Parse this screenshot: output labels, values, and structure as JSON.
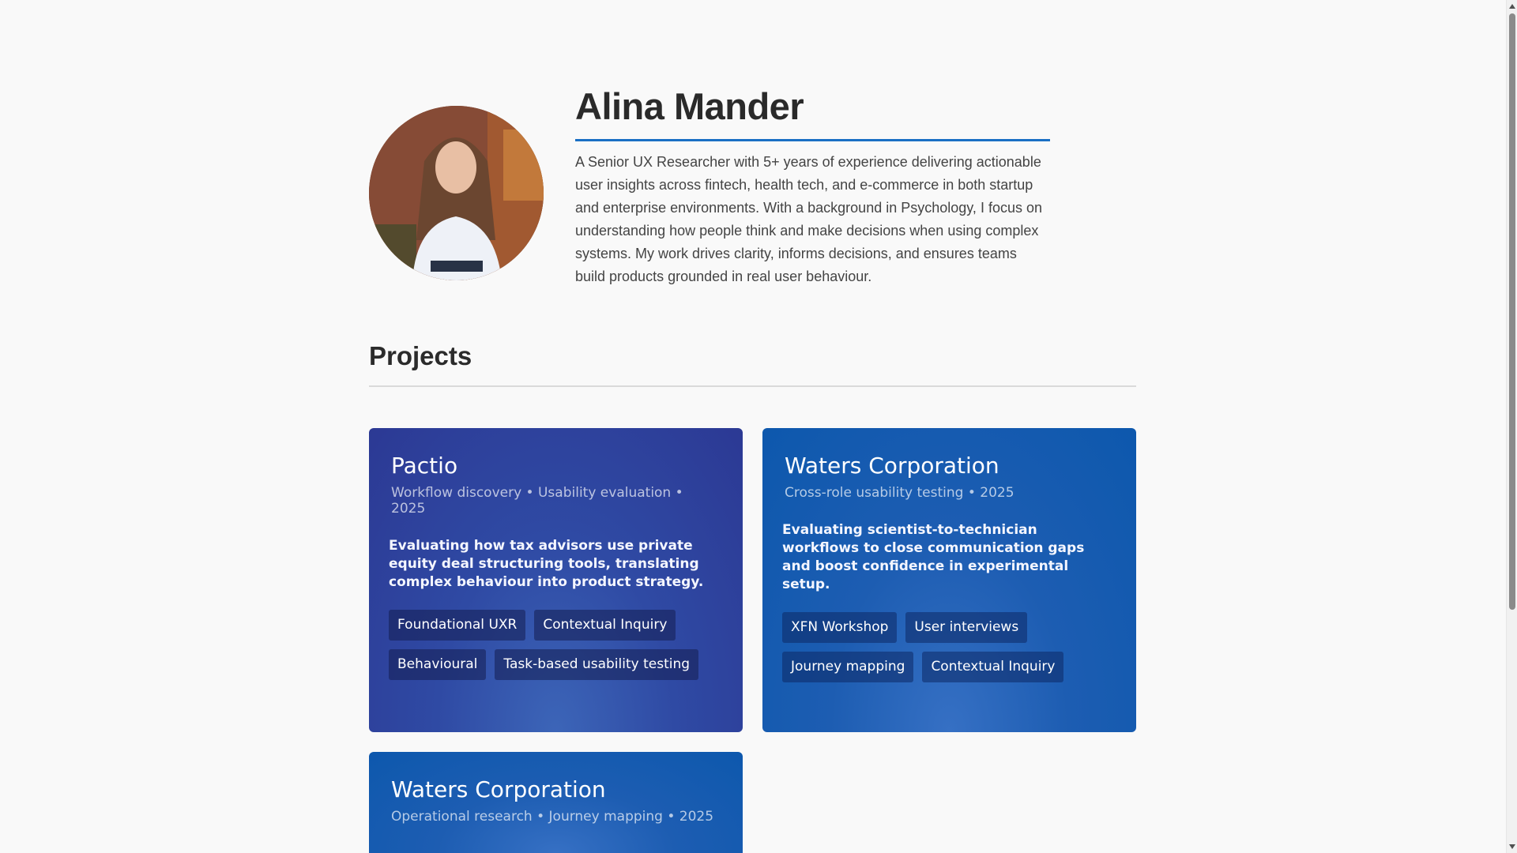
{
  "profile": {
    "name": "Alina Mander",
    "bio": "A Senior UX Researcher with 5+ years of experience delivering actionable user insights across fintech, health tech, and e-commerce in both startup and enterprise environments. With a background in Psychology, I focus on understanding how people think and make decisions when using complex systems. My work drives clarity, informs decisions, and ensures teams build products grounded in real user behaviour."
  },
  "projects": {
    "title": "Projects",
    "cards": [
      {
        "title": "Pactio",
        "meta": "Workflow discovery • Usability evaluation • 2025",
        "description": "Evaluating how tax advisors use private equity deal structuring tools, translating complex behaviour into product strategy.",
        "tags": [
          "Foundational UXR",
          "Contextual Inquiry",
          "Behavioural",
          "Task-based usability testing"
        ],
        "theme": "#2c3994"
      },
      {
        "title": "Waters Corporation",
        "meta": "Cross-role usability testing • 2025",
        "description": "Evaluating scientist-to-technician workflows to close communication gaps and boost confidence in experimental setup.",
        "tags": [
          "XFN Workshop",
          "User interviews",
          "Journey mapping",
          "Contextual Inquiry"
        ],
        "theme": "#0d58ad"
      },
      {
        "title": "Waters Corporation",
        "meta": "Operational research • Journey mapping • 2025",
        "theme": "#0d58ad"
      }
    ]
  }
}
